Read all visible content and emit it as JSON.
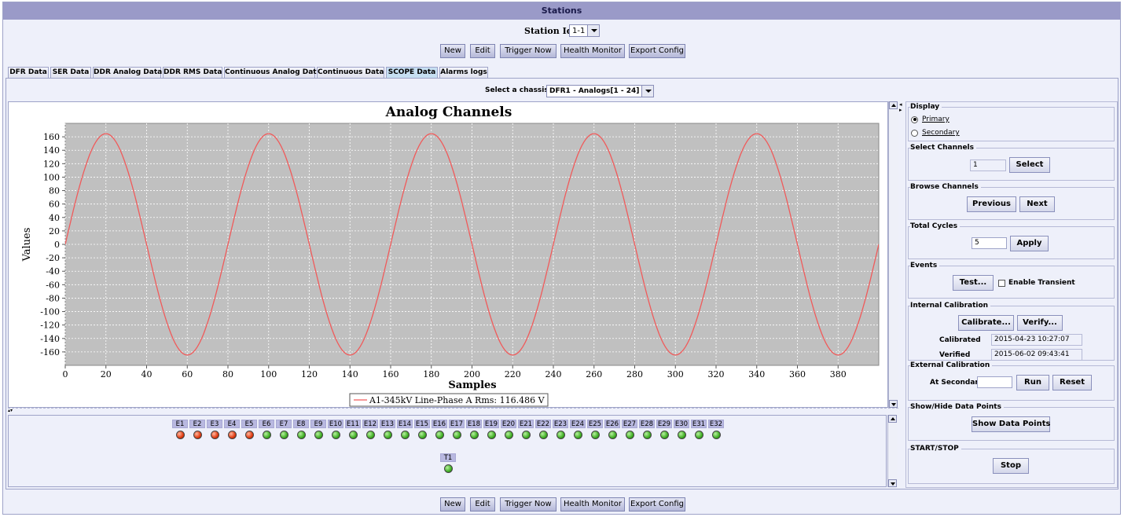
{
  "window": {
    "title": "Stations"
  },
  "station": {
    "label": "Station Id:",
    "value": "1-1"
  },
  "toolbar": {
    "new": "New",
    "edit": "Edit",
    "trigger_now": "Trigger Now",
    "health_monitor": "Health Monitor",
    "export_config": "Export Config"
  },
  "tabs": [
    {
      "label": "DFR Data"
    },
    {
      "label": "SER Data"
    },
    {
      "label": "DDR Analog Data"
    },
    {
      "label": "DDR RMS Data"
    },
    {
      "label": "Continuous Analog Data"
    },
    {
      "label": "Continuous Data"
    },
    {
      "label": "SCOPE Data",
      "active": true
    },
    {
      "label": "Alarms logs"
    }
  ],
  "chassis": {
    "label": "Select a chassis:",
    "value": "DFR1 - Analogs[1 - 24]"
  },
  "chart_data": {
    "type": "line",
    "title": "Analog Channels",
    "xlabel": "Samples",
    "ylabel": "Values",
    "xlim": [
      0,
      400
    ],
    "ylim": [
      -180,
      180
    ],
    "xticks": [
      0,
      20,
      40,
      60,
      80,
      100,
      120,
      140,
      160,
      180,
      200,
      220,
      240,
      260,
      280,
      300,
      320,
      340,
      360,
      380
    ],
    "yticks": [
      -160,
      -140,
      -120,
      -100,
      -80,
      -60,
      -40,
      -20,
      0,
      20,
      40,
      60,
      80,
      100,
      120,
      140,
      160
    ],
    "grid": true,
    "legend_position": "bottom",
    "series": [
      {
        "name": "A1-345kV Line-Phase A Rms: 116.486 V",
        "color": "#f05a5a",
        "amplitude": 164.7,
        "period_samples": 80,
        "phase_start_value": 0,
        "x_start": 0,
        "x_end": 400
      }
    ]
  },
  "events": {
    "labels": [
      "E1",
      "E2",
      "E3",
      "E4",
      "E5",
      "E6",
      "E7",
      "E8",
      "E9",
      "E10",
      "E11",
      "E12",
      "E13",
      "E14",
      "E15",
      "E16",
      "E17",
      "E18",
      "E19",
      "E20",
      "E21",
      "E22",
      "E23",
      "E24",
      "E25",
      "E26",
      "E27",
      "E28",
      "E29",
      "E30",
      "E31",
      "E32"
    ],
    "states": [
      "red",
      "red",
      "red",
      "red",
      "red",
      "green",
      "green",
      "green",
      "green",
      "green",
      "green",
      "green",
      "green",
      "green",
      "green",
      "green",
      "green",
      "green",
      "green",
      "green",
      "green",
      "green",
      "green",
      "green",
      "green",
      "green",
      "green",
      "green",
      "green",
      "green",
      "green",
      "green"
    ],
    "trigger": {
      "label": "T1",
      "state": "green"
    }
  },
  "panel": {
    "display": {
      "title": "Display",
      "primary": "Primary",
      "secondary": "Secondary"
    },
    "select_channels": {
      "title": "Select Channels",
      "value": "1",
      "button": "Select"
    },
    "browse_channels": {
      "title": "Browse Channels",
      "previous": "Previous",
      "next": "Next"
    },
    "total_cycles": {
      "title": "Total Cycles",
      "value": "5",
      "button": "Apply"
    },
    "events": {
      "title": "Events",
      "test": "Test...",
      "enable_transient": "Enable Transient"
    },
    "internal_calibration": {
      "title": "Internal Calibration",
      "calibrate": "Calibrate...",
      "verify": "Verify...",
      "calibrated_label": "Calibrated",
      "calibrated_value": "2015-04-23 10:27:07",
      "verified_label": "Verified",
      "verified_value": "2015-06-02 09:43:41"
    },
    "external_calibration": {
      "title": "External Calibration",
      "at_secondary": "At Secondary",
      "run": "Run",
      "reset": "Reset"
    },
    "show_hide": {
      "title": "Show/Hide Data Points",
      "button": "Show Data Points"
    },
    "start_stop": {
      "title": "START/STOP",
      "button": "Stop"
    }
  }
}
